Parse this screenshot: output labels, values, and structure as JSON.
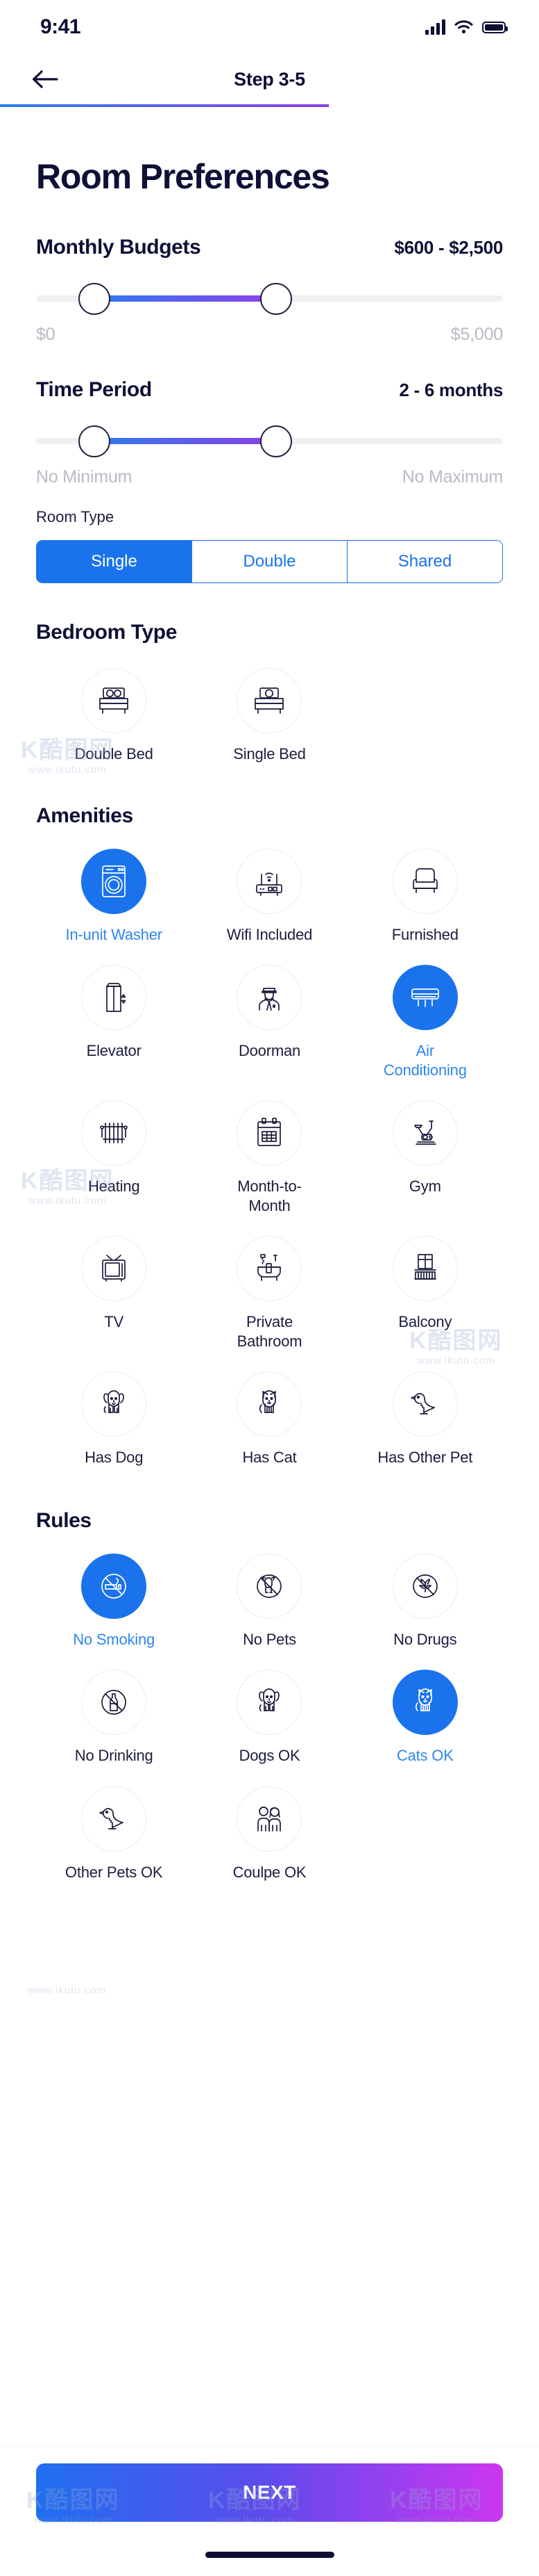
{
  "status_bar": {
    "time": "9:41",
    "icons": [
      "signal-bars-icon",
      "wifi-icon",
      "battery-icon"
    ]
  },
  "header": {
    "back_icon": "arrow-left-icon",
    "title": "Step 3-5",
    "progress_percent": 61
  },
  "page_title": "Room Preferences",
  "budget": {
    "label": "Monthly Budgets",
    "value": "$600 - $2,500",
    "min_label": "$0",
    "max_label": "$5,000",
    "min_value": 600,
    "max_value": 2500,
    "range_min": 0,
    "range_max": 5000
  },
  "time_period": {
    "label": "Time Period",
    "value": "2 - 6 months",
    "min_label": "No Minimum",
    "max_label": "No Maximum"
  },
  "room_type": {
    "label": "Room Type",
    "options": [
      {
        "label": "Single",
        "selected": true
      },
      {
        "label": "Double",
        "selected": false
      },
      {
        "label": "Shared",
        "selected": false
      }
    ]
  },
  "bedroom_type": {
    "title": "Bedroom Type",
    "options": [
      {
        "label": "Double Bed",
        "icon": "double-bed-icon",
        "selected": false
      },
      {
        "label": "Single Bed",
        "icon": "single-bed-icon",
        "selected": false
      }
    ]
  },
  "amenities": {
    "title": "Amenities",
    "options": [
      {
        "label": "In-unit Washer",
        "icon": "washing-machine-icon",
        "selected": true
      },
      {
        "label": "Wifi Included",
        "icon": "wifi-router-icon",
        "selected": false
      },
      {
        "label": "Furnished",
        "icon": "armchair-icon",
        "selected": false
      },
      {
        "label": "Elevator",
        "icon": "elevator-icon",
        "selected": false
      },
      {
        "label": "Doorman",
        "icon": "doorman-icon",
        "selected": false
      },
      {
        "label": "Air Conditioning",
        "icon": "air-conditioner-icon",
        "selected": true
      },
      {
        "label": "Heating",
        "icon": "radiator-icon",
        "selected": false
      },
      {
        "label": "Month-to-Month",
        "icon": "calendar-icon",
        "selected": false
      },
      {
        "label": "Gym",
        "icon": "exercise-bike-icon",
        "selected": false
      },
      {
        "label": "TV",
        "icon": "television-icon",
        "selected": false
      },
      {
        "label": "Private Bathroom",
        "icon": "bathtub-icon",
        "selected": false
      },
      {
        "label": "Balcony",
        "icon": "balcony-icon",
        "selected": false
      },
      {
        "label": "Has Dog",
        "icon": "dog-icon",
        "selected": false
      },
      {
        "label": "Has Cat",
        "icon": "cat-icon",
        "selected": false
      },
      {
        "label": "Has Other Pet",
        "icon": "bird-icon",
        "selected": false
      }
    ]
  },
  "rules": {
    "title": "Rules",
    "options": [
      {
        "label": "No Smoking",
        "icon": "no-smoking-icon",
        "selected": true
      },
      {
        "label": "No Pets",
        "icon": "no-pets-icon",
        "selected": false
      },
      {
        "label": "No Drugs",
        "icon": "no-drugs-icon",
        "selected": false
      },
      {
        "label": "No Drinking",
        "icon": "no-drinking-icon",
        "selected": false
      },
      {
        "label": "Dogs OK",
        "icon": "dog-icon",
        "selected": false
      },
      {
        "label": "Cats OK",
        "icon": "cat-icon",
        "selected": true
      },
      {
        "label": "Other Pets OK",
        "icon": "bird-icon",
        "selected": false
      },
      {
        "label": "Coulpe OK",
        "icon": "couple-icon",
        "selected": false
      }
    ]
  },
  "footer": {
    "next_label": "NEXT"
  },
  "watermark": {
    "brand": "K酷图网",
    "site": "www.ikutu.com"
  },
  "colors": {
    "accent_blue": "#1a73ec",
    "label_blue": "#2f86f0",
    "dark_navy": "#0f1036",
    "muted_grey": "#b9bac4",
    "gradient_start": "#1f6ff0",
    "gradient_end": "#cc36f0"
  }
}
